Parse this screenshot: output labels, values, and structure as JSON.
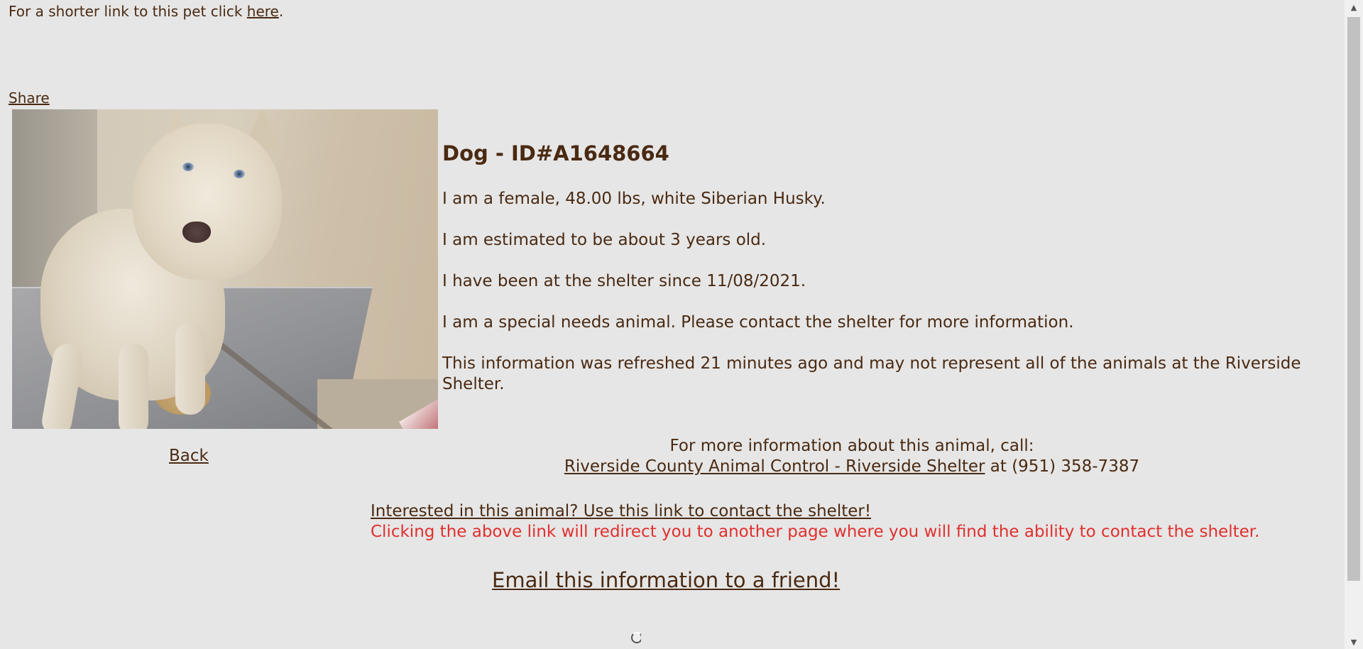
{
  "header": {
    "short_link_prefix": "For a shorter link to this pet click",
    "short_link_label": "here",
    "short_link_suffix": ".",
    "share_label": "Share"
  },
  "animal": {
    "title": "Dog - ID#A1648664",
    "description": "I am a female, 48.00 lbs, white Siberian Husky.",
    "age": "I am estimated to be about 3 years old.",
    "since": "I have been at the shelter since 11/08/2021.",
    "special_needs": "I am a special needs animal. Please contact the shelter for more information.",
    "refresh_note": "This information was refreshed 21 minutes ago and may not represent all of the animals at the Riverside Shelter."
  },
  "nav": {
    "back_label": "Back"
  },
  "contact": {
    "intro": "For more information about this animal, call:",
    "shelter_link": "Riverside County Animal Control - Riverside Shelter",
    "phone_text": " at (951) 358-7387",
    "interested_link": "Interested in this animal? Use this link to contact the shelter!",
    "redirect_note": "Clicking the above link will redirect you to another page where you will find the ability to contact the shelter.",
    "email_link": "Email this information to a friend!"
  },
  "colors": {
    "text": "#4a2a12",
    "background": "#e6e6e6",
    "warning": "#e0302e"
  },
  "icons": {
    "scroll_up": "triangle-up-icon",
    "scroll_down": "triangle-down-icon",
    "loading": "spinner-icon"
  }
}
